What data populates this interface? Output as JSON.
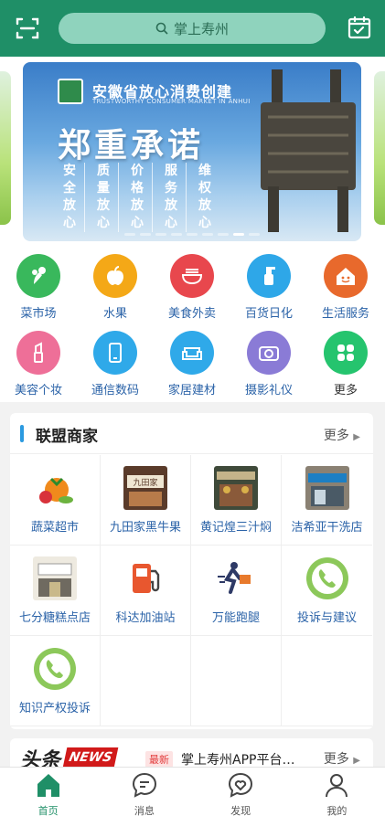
{
  "header": {
    "search_placeholder": "掌上寿州",
    "colors": {
      "brand": "#1f8f67"
    }
  },
  "banner": {
    "org_cn": "安徽省放心消费创建",
    "org_en": "TRUSTWORTHY CONSUMER MARKET IN ANHUI",
    "title": "郑重承诺",
    "columns": [
      {
        "l1": "安",
        "l2": "全",
        "l3": "放",
        "l4": "心"
      },
      {
        "l1": "质",
        "l2": "量",
        "l3": "放",
        "l4": "心"
      },
      {
        "l1": "价",
        "l2": "格",
        "l3": "放",
        "l4": "心"
      },
      {
        "l1": "服",
        "l2": "务",
        "l3": "放",
        "l4": "心"
      },
      {
        "l1": "维",
        "l2": "权",
        "l3": "放",
        "l4": "心"
      }
    ],
    "page_count": 9,
    "active_page": 7
  },
  "categories": [
    {
      "label": "菜市场",
      "icon": "vegetable-icon",
      "color": "#39b85c"
    },
    {
      "label": "水果",
      "icon": "apple-icon",
      "color": "#f4a817"
    },
    {
      "label": "美食外卖",
      "icon": "noodle-bowl-icon",
      "color": "#e8474d"
    },
    {
      "label": "百货日化",
      "icon": "spray-bottle-icon",
      "color": "#2ea7e8"
    },
    {
      "label": "生活服务",
      "icon": "house-face-icon",
      "color": "#e8692c"
    },
    {
      "label": "美容个妆",
      "icon": "lipstick-icon",
      "color": "#ee6f98"
    },
    {
      "label": "通信数码",
      "icon": "phone-icon",
      "color": "#2fa9e9"
    },
    {
      "label": "家居建材",
      "icon": "sofa-icon",
      "color": "#2fa9e9"
    },
    {
      "label": "摄影礼仪",
      "icon": "camera-icon",
      "color": "#8a7bd6"
    },
    {
      "label": "更多",
      "icon": "grid-icon",
      "color": "#25c46e"
    }
  ],
  "merchants": {
    "title": "联盟商家",
    "more": "更多",
    "items": [
      {
        "label": "蔬菜超市",
        "icon": "vegetables-thumb-icon"
      },
      {
        "label": "九田家黑牛果",
        "icon": "storefront-thumb-icon"
      },
      {
        "label": "黄记煌三汁焖",
        "icon": "restaurant-thumb-icon"
      },
      {
        "label": "洁希亚干洗店",
        "icon": "laundry-thumb-icon"
      },
      {
        "label": "七分糖糕点店",
        "icon": "bakery-thumb-icon"
      },
      {
        "label": "科达加油站",
        "icon": "fuel-pump-icon"
      },
      {
        "label": "万能跑腿",
        "icon": "delivery-runner-icon"
      },
      {
        "label": "投诉与建议",
        "icon": "phone-call-icon"
      },
      {
        "label": "知识产权投诉",
        "icon": "phone-call-icon"
      }
    ]
  },
  "news": {
    "logo_a": "头条",
    "logo_b": "NEWS",
    "tag": "最新",
    "headline": "掌上寿州APP平台…",
    "more": "更多"
  },
  "tabbar": [
    {
      "label": "首页",
      "icon": "home-icon",
      "active": true
    },
    {
      "label": "消息",
      "icon": "message-icon",
      "active": false
    },
    {
      "label": "发现",
      "icon": "heart-chat-icon",
      "active": false
    },
    {
      "label": "我的",
      "icon": "user-icon",
      "active": false
    }
  ]
}
